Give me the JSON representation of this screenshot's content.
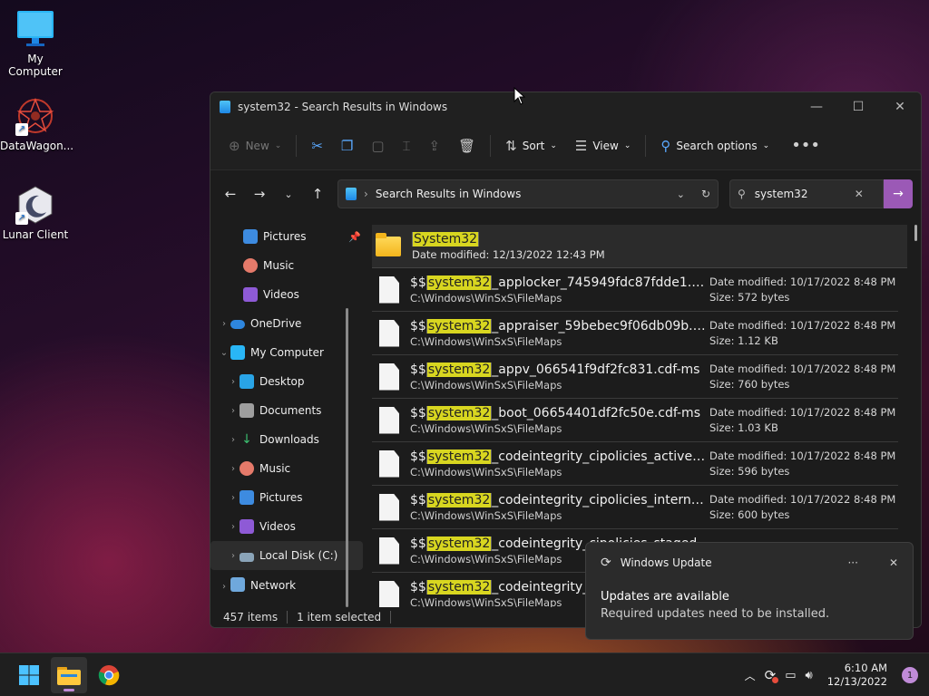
{
  "desktop": {
    "icons": [
      {
        "label": "My Computer"
      },
      {
        "label": "DataWagon..."
      },
      {
        "label": "Lunar Client"
      }
    ]
  },
  "window": {
    "title": "system32 - Search Results in Windows",
    "toolbar": {
      "new_label": "New",
      "sort_label": "Sort",
      "view_label": "View",
      "search_options_label": "Search options"
    },
    "address": "Search Results in Windows",
    "search_value": "system32"
  },
  "sidebar": {
    "items": [
      {
        "label": "Pictures"
      },
      {
        "label": "Music"
      },
      {
        "label": "Videos"
      },
      {
        "label": "OneDrive"
      },
      {
        "label": "My Computer"
      },
      {
        "label": "Desktop"
      },
      {
        "label": "Documents"
      },
      {
        "label": "Downloads"
      },
      {
        "label": "Music"
      },
      {
        "label": "Pictures"
      },
      {
        "label": "Videos"
      },
      {
        "label": "Local Disk (C:)"
      },
      {
        "label": "Network"
      }
    ]
  },
  "results": {
    "folder": {
      "name": "System32",
      "date": "Date modified:  12/13/2022 12:43 PM"
    },
    "prefix": "$$",
    "match": "system32",
    "files": [
      {
        "suffix": "_applocker_745949fdc87fdde1.cd...",
        "path": "C:\\Windows\\WinSxS\\FileMaps",
        "date": "Date modified:  10/17/2022 8:48 PM",
        "size": "Size:  572 bytes"
      },
      {
        "suffix": "_appraiser_59bebec9f06db09b.cd...",
        "path": "C:\\Windows\\WinSxS\\FileMaps",
        "date": "Date modified:  10/17/2022 8:48 PM",
        "size": "Size:  1.12 KB"
      },
      {
        "suffix": "_appv_066541f9df2fc831.cdf-ms",
        "path": "C:\\Windows\\WinSxS\\FileMaps",
        "date": "Date modified:  10/17/2022 8:48 PM",
        "size": "Size:  760 bytes"
      },
      {
        "suffix": "_boot_06654401df2fc50e.cdf-ms",
        "path": "C:\\Windows\\WinSxS\\FileMaps",
        "date": "Date modified:  10/17/2022 8:48 PM",
        "size": "Size:  1.03 KB"
      },
      {
        "suffix": "_codeintegrity_cipolicies_active_2...",
        "path": "C:\\Windows\\WinSxS\\FileMaps",
        "date": "Date modified:  10/17/2022 8:48 PM",
        "size": "Size:  596 bytes"
      },
      {
        "suffix": "_codeintegrity_cipolicies_internal_...",
        "path": "C:\\Windows\\WinSxS\\FileMaps",
        "date": "Date modified:  10/17/2022 8:48 PM",
        "size": "Size:  600 bytes"
      },
      {
        "suffix": "_codeintegrity_cipolicies_staged",
        "path": "C:\\Windows\\WinSxS\\FileMaps",
        "date": "",
        "size": ""
      },
      {
        "suffix": "_codeintegrity_e9",
        "path": "C:\\Windows\\WinSxS\\FileMaps",
        "date": "",
        "size": ""
      }
    ]
  },
  "status": {
    "count": "457 items",
    "selected": "1 item selected"
  },
  "toast": {
    "app": "Windows Update",
    "title": "Updates are available",
    "body": "Required updates need to be installed."
  },
  "taskbar": {
    "time": "6:10 AM",
    "date": "12/13/2022",
    "notifications": "1"
  },
  "colors": {
    "accent": "#9b59b6",
    "highlight": "#d8d620"
  }
}
